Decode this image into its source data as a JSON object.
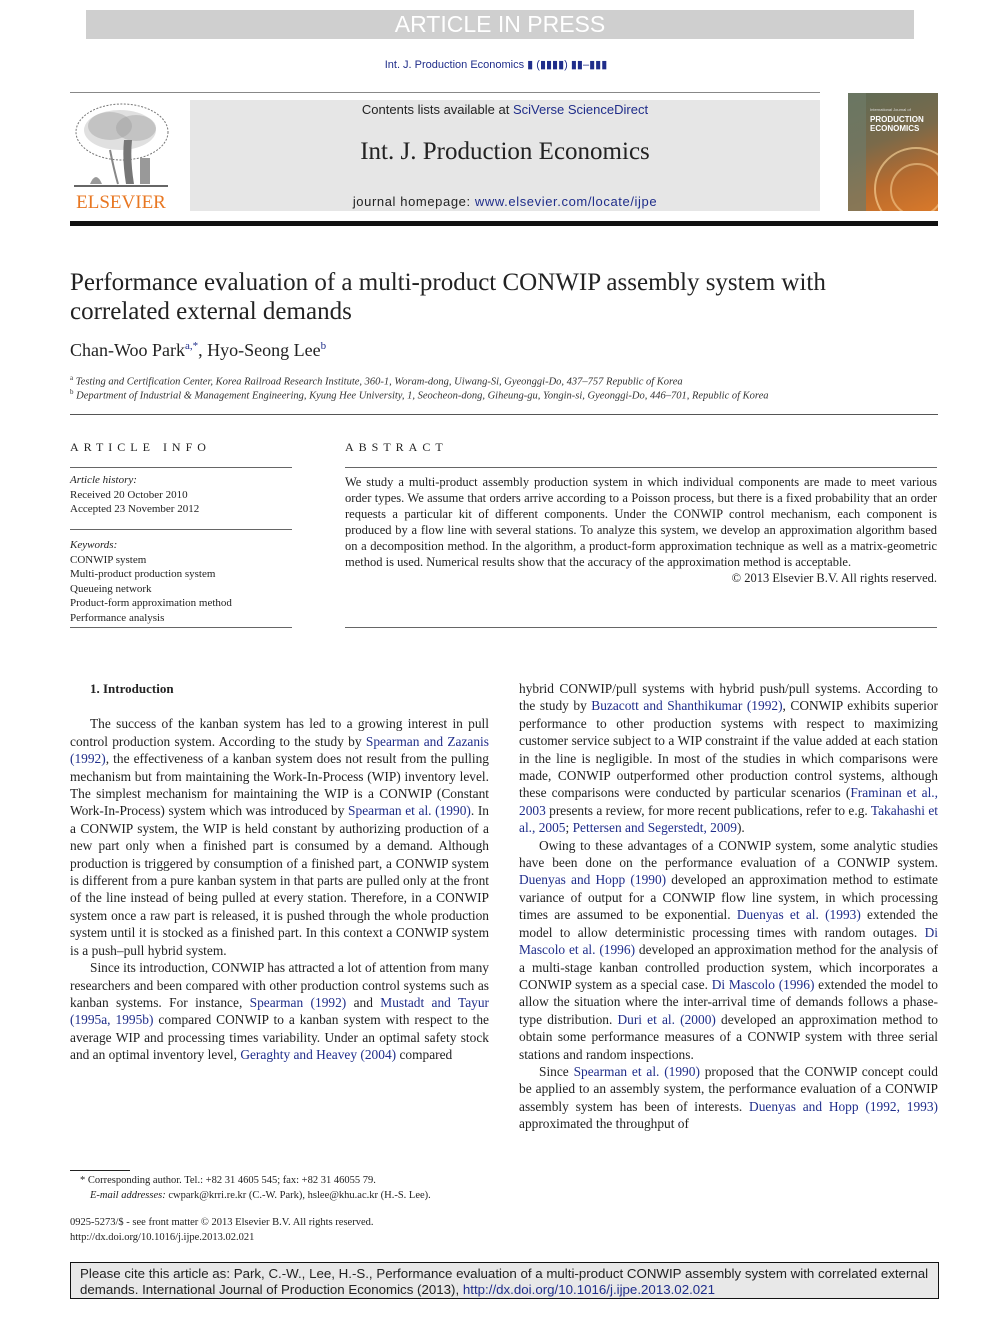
{
  "banner": "ARTICLE IN PRESS",
  "running_head": "Int. J. Production Economics ▮ (▮▮▮▮) ▮▮–▮▮▮",
  "publisher": {
    "name": "ELSEVIER",
    "color": "#e87722"
  },
  "masthead": {
    "contents_prefix": "Contents lists available at ",
    "contents_link": "SciVerse ScienceDirect",
    "journal_title": "Int. J. Production Economics",
    "homepage_prefix": "journal homepage: ",
    "homepage_link": "www.elsevier.com/locate/ijpe"
  },
  "cover": {
    "small": "International Journal of",
    "title_line1": "PRODUCTION",
    "title_line2": "ECONOMICS"
  },
  "article": {
    "title": "Performance evaluation of a multi-product CONWIP assembly system with correlated external demands",
    "authors": [
      {
        "name": "Chan-Woo Park",
        "marks": "a,*"
      },
      {
        "name": "Hyo-Seong Lee",
        "marks": "b"
      }
    ],
    "affiliations": [
      {
        "mark": "a",
        "text": "Testing and Certification Center, Korea Railroad Research Institute, 360-1, Woram-dong, Uiwang-Si, Gyeonggi-Do, 437–757 Republic of Korea"
      },
      {
        "mark": "b",
        "text": "Department of Industrial & Management Engineering, Kyung Hee University, 1, Seocheon-dong, Giheung-gu, Yongin-si, Gyeonggi-Do, 446–701, Republic of Korea"
      }
    ]
  },
  "article_info": {
    "heading": "ARTICLE INFO",
    "history_label": "Article history:",
    "received": "Received 20 October 2010",
    "accepted": "Accepted 23 November 2012",
    "keywords_label": "Keywords:",
    "keywords": [
      "CONWIP system",
      "Multi-product production system",
      "Queueing network",
      "Product-form approximation method",
      "Performance analysis"
    ]
  },
  "abstract": {
    "heading": "ABSTRACT",
    "text": "We study a multi-product assembly production system in which individual components are made to meet various order types. We assume that orders arrive according to a Poisson process, but there is a fixed probability that an order requests a particular kit of different components. Under the CONWIP control mechanism, each component is produced by a flow line with several stations. To analyze this system, we develop an approximation algorithm based on a decomposition method. In the algorithm, a product-form approximation technique as well as a matrix-geometric method is used. Numerical results show that the accuracy of the approximation method is acceptable.",
    "copyright": "© 2013 Elsevier B.V. All rights reserved."
  },
  "body": {
    "section_heading": "1.  Introduction",
    "left": {
      "p1": [
        "The success of the kanban system has led to a growing interest in pull control production system. According to the study by ",
        "Spearman and Zazanis (1992)",
        ", the effectiveness of a kanban system does not result from the pulling mechanism but from maintaining the Work-In-Process (WIP) inventory level. The simplest mechanism for maintaining the WIP is a CONWIP (Constant Work-In-Process) system which was introduced by ",
        "Spearman et al. (1990)",
        ". In a CONWIP system, the WIP is held constant by authorizing production of a new part only when a finished part is consumed by a demand. Although production is triggered by consumption of a finished part, a CONWIP system is different from a pure kanban system in that parts are pulled only at the front of the line instead of being pulled at every station. Therefore, in a CONWIP system once a raw part is released, it is pushed through the whole production system until it is stocked as a finished part. In this context a CONWIP system is a push–pull hybrid system."
      ],
      "p2": [
        "Since its introduction, CONWIP has attracted a lot of attention from many researchers and been compared with other production control systems such as kanban systems. For instance, ",
        "Spearman (1992)",
        " and ",
        "Mustadt and Tayur (1995a, 1995b)",
        " compared CONWIP to a kanban system with respect to the average WIP and processing times variability. Under an optimal safety stock and an optimal inventory level, ",
        "Geraghty and Heavey (2004)",
        " compared"
      ]
    },
    "right": {
      "p1": [
        "hybrid CONWIP/pull systems with hybrid push/pull systems. According to the study by ",
        "Buzacott and Shanthikumar (1992)",
        ", CONWIP exhibits superior performance to other production systems with respect to maximizing customer service subject to a WIP constraint if the value added at each station in the line is negligible. In most of the studies in which comparisons were made, CONWIP outperformed other production control systems, although these comparisons were conducted by particular scenarios (",
        "Framinan et al., 2003",
        " presents a review, for more recent publications, refer to e.g. ",
        "Takahashi et al., 2005",
        "; ",
        "Pettersen and Segerstedt, 2009",
        ")."
      ],
      "p2": [
        "Owing to these advantages of a CONWIP system, some analytic studies have been done on the performance evaluation of a CONWIP system. ",
        "Duenyas and Hopp (1990)",
        " developed an approximation method to estimate variance of output for a CONWIP flow line system, in which processing times are assumed to be exponential. ",
        "Duenyas et al. (1993)",
        " extended the model to allow deterministic processing times with random outages. ",
        "Di Mascolo et al. (1996)",
        " developed an approximation method for the analysis of a multi-stage kanban controlled production system, which incorporates a CONWIP system as a special case. ",
        "Di Mascolo (1996)",
        " extended the model to allow the situation where the inter-arrival time of demands follows a phase-type distribution. ",
        "Duri et al. (2000)",
        " developed an approximation method to obtain some performance measures of a CONWIP system with three serial stations and random inspections."
      ],
      "p3": [
        "Since ",
        "Spearman et al. (1990)",
        " proposed that the CONWIP concept could be applied to an assembly system, the performance evaluation of a CONWIP assembly system has been of interests. ",
        "Duenyas and Hopp (1992, 1993)",
        " approximated the throughput of"
      ]
    }
  },
  "footnote": {
    "corresponding": "* Corresponding author. Tel.: +82 31 4605 545; fax: +82 31 46055 79.",
    "email_label": "E-mail addresses:",
    "emails": " cwpark@krri.re.kr (C.-W. Park), hslee@khu.ac.kr (H.-S. Lee)."
  },
  "front_matter": {
    "issn": "0925-5273/$ - see front matter © 2013 Elsevier B.V. All rights reserved.",
    "doi": "http://dx.doi.org/10.1016/j.ijpe.2013.02.021"
  },
  "citation_box": {
    "text": "Please cite this article as: Park, C.-W., Lee, H.-S., Performance evaluation of a multi-product CONWIP assembly system with correlated external demands. International Journal of Production Economics (2013), ",
    "link": "http://dx.doi.org/10.1016/j.ijpe.2013.02.021"
  }
}
